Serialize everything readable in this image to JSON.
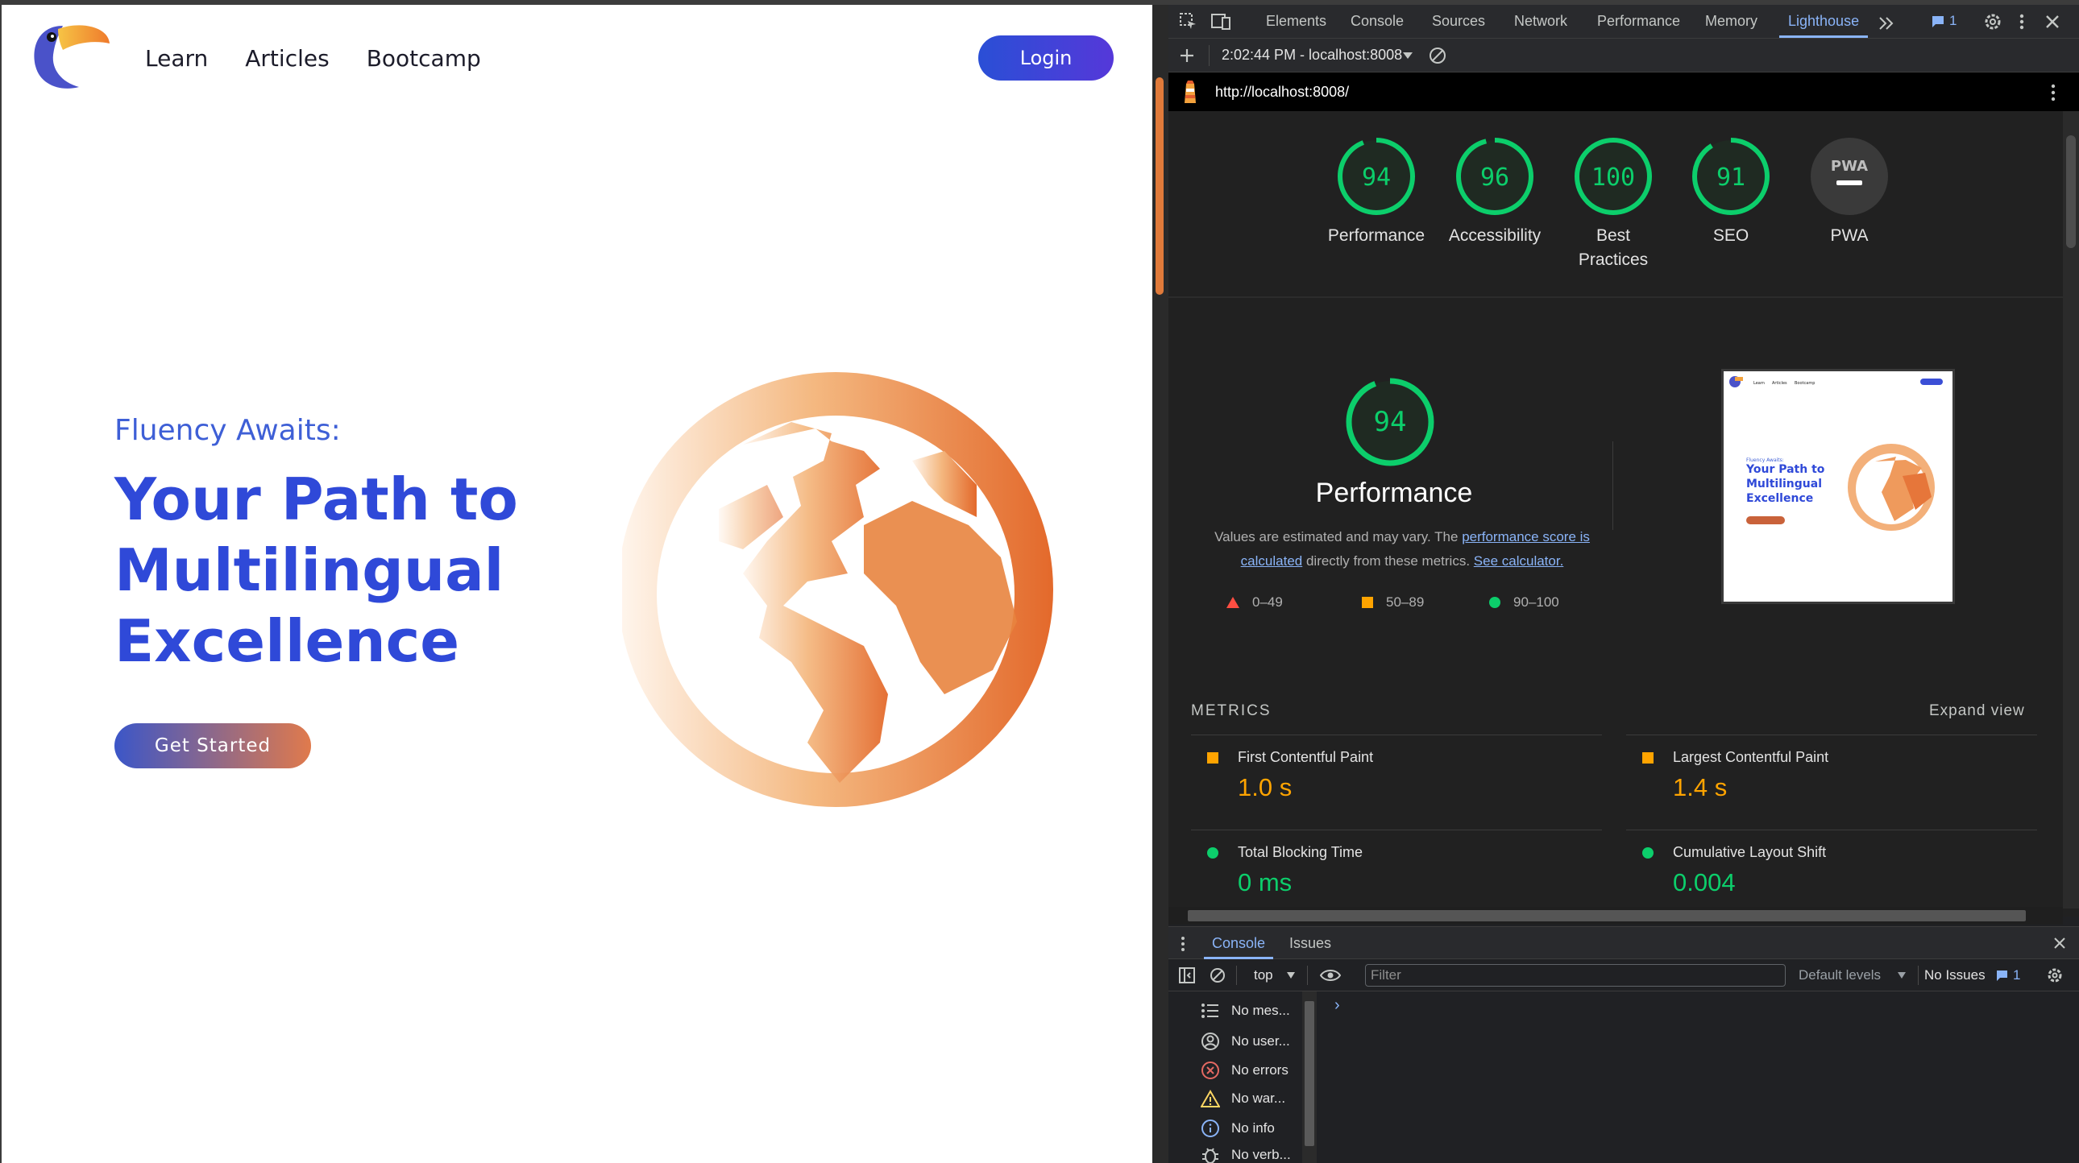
{
  "site": {
    "nav": [
      "Learn",
      "Articles",
      "Bootcamp"
    ],
    "login_label": "Login",
    "kicker": "Fluency Awaits:",
    "headline": "Your Path to Multilingual Excellence",
    "cta_label": "Get Started",
    "colors": {
      "brand_blue": "#2f49d8",
      "brand_orange": "#e07a3a"
    }
  },
  "devtools": {
    "tabs": [
      "Elements",
      "Console",
      "Sources",
      "Network",
      "Performance",
      "Memory",
      "Lighthouse"
    ],
    "active_tab": "Lighthouse",
    "issues_badge": "1",
    "report_time": "2:02:44 PM - localhost:8008",
    "url": "http://localhost:8008/",
    "categories": [
      {
        "label": "Performance",
        "score": 94
      },
      {
        "label": "Accessibility",
        "score": 96
      },
      {
        "label": "Best Practices",
        "score": 100
      },
      {
        "label": "SEO",
        "score": 91
      },
      {
        "label": "PWA",
        "score": null
      }
    ],
    "pwa_icon_text": "PWA",
    "perf": {
      "score": "94",
      "title": "Performance",
      "desc_prefix": "Values are estimated and may vary. The ",
      "desc_link1": "performance score is calculated",
      "desc_middle": " directly from these metrics. ",
      "desc_link2": "See calculator.",
      "legend": [
        "0–49",
        "50–89",
        "90–100"
      ]
    },
    "metrics_heading": "METRICS",
    "expand_label": "Expand view",
    "metrics": [
      {
        "name": "First Contentful Paint",
        "value": "1.0 s",
        "rating": "average"
      },
      {
        "name": "Largest Contentful Paint",
        "value": "1.4 s",
        "rating": "average"
      },
      {
        "name": "Total Blocking Time",
        "value": "0 ms",
        "rating": "pass"
      },
      {
        "name": "Cumulative Layout Shift",
        "value": "0.004",
        "rating": "pass"
      }
    ],
    "thumbnail": {
      "nav": [
        "Learn",
        "Articles",
        "Bootcamp"
      ],
      "kicker": "Fluency Awaits:",
      "headline": "Your Path to Multilingual Excellence"
    },
    "drawer": {
      "tabs": [
        "Console",
        "Issues"
      ],
      "context": "top",
      "filter_placeholder": "Filter",
      "levels": "Default levels",
      "no_issues": "No Issues",
      "issue_count": "1",
      "sidebar": [
        "No mes...",
        "No user...",
        "No errors",
        "No war...",
        "No info",
        "No verb..."
      ]
    },
    "colors": {
      "pass": "#0cce6b",
      "average": "#ffa400",
      "fail": "#ff4e42",
      "link": "#8ab4f8"
    }
  }
}
